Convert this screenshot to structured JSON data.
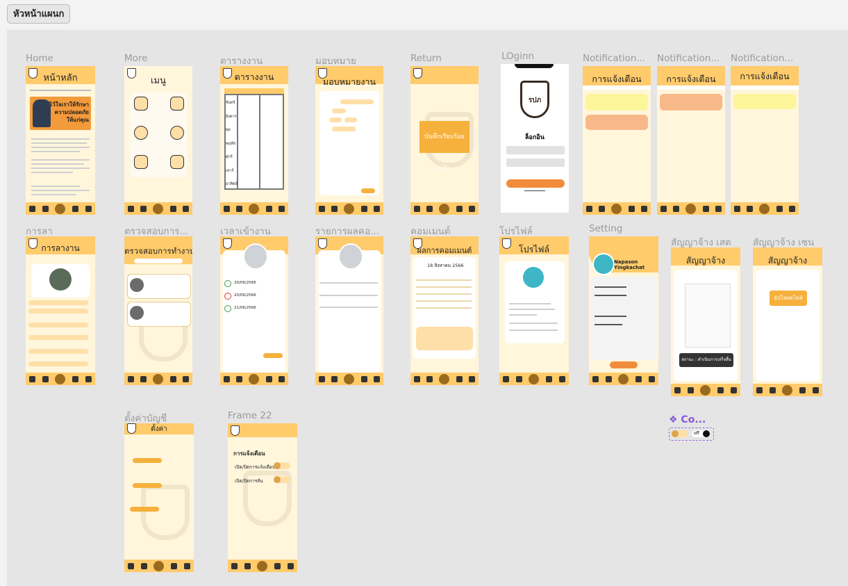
{
  "page_button": "หัวหน้าแผนก",
  "frames": {
    "home": {
      "label": "Home",
      "title": "หน้าหลัก",
      "banner_line1": "ไว้ใจเราให้รักษา",
      "banner_line2": "ความปลอดภัย",
      "banner_line3": "ให้แก่คุณ"
    },
    "more": {
      "label": "More",
      "title": "เมนู"
    },
    "schedule": {
      "label": "ตารางงาน",
      "title": "ตารางงาน",
      "days": [
        "จันทร์",
        "อังคาร",
        "พุธ",
        "พฤหัส",
        "ศุกร์",
        "เสาร์",
        "อาทิตย์"
      ]
    },
    "assign": {
      "label": "มอบหมาย",
      "title": "มอบหมายงาน"
    },
    "return": {
      "label": "Return",
      "message": "บันทึกเรียบร้อยแล้ว"
    },
    "login": {
      "label": "LOginn",
      "heading": "ล็อกอิน",
      "logo_text": "รปภ"
    },
    "notif1": {
      "label": "Notification...",
      "title": "การแจ้งเตือน"
    },
    "notif2": {
      "label": "Notification...",
      "title": "การแจ้งเตือน"
    },
    "notif3": {
      "label": "Notification...",
      "title": "การแจ้งเตือน"
    },
    "leave": {
      "label": "การลา",
      "title": "การลางาน"
    },
    "check": {
      "label": "ตรวจสอบการ...",
      "title": "ตรวจสอบการทำงาน"
    },
    "clock": {
      "label": "เวลาเข้างาน",
      "rows": [
        "20/06/2566",
        "20/06/2566",
        "21/06/2566"
      ]
    },
    "report": {
      "label": "รายการผลคอ..."
    },
    "comment": {
      "label": "คอมเมนต์",
      "title": "ผลการคอมเมนต์",
      "date": "18 สิงหาคม 2566"
    },
    "profile": {
      "label": "โปรไฟล์",
      "title": "โปรไฟล์"
    },
    "setting": {
      "label": "Setting",
      "user": "Napason Yingkachat"
    },
    "contract_done": {
      "label": "สัญญาจ้าง เสต",
      "title": "สัญญาจ้าง",
      "status": "สถานะ : ดำเนินการเสร็จสิ้น"
    },
    "contract_sign": {
      "label": "สัญญาจ้าง เซน",
      "title": "สัญญาจ้าง",
      "upload": "อัปโหลดไฟล์"
    },
    "account": {
      "label": "ตั้งค่าบัญชี",
      "title": "ตั้งค่า"
    },
    "frame22": {
      "label": "Frame 22",
      "heading": "การแจ้งเตือน",
      "opt1": "เปิด/ปิดการแจ้งเตือน",
      "opt2": "เปิด/ปิดการสั่น"
    }
  },
  "component": {
    "label": "❖ Co...",
    "off": "off"
  },
  "colors": {
    "header": "#ffcb6b",
    "frame_bg": "#fff6dc",
    "accent": "#f6b03c"
  }
}
